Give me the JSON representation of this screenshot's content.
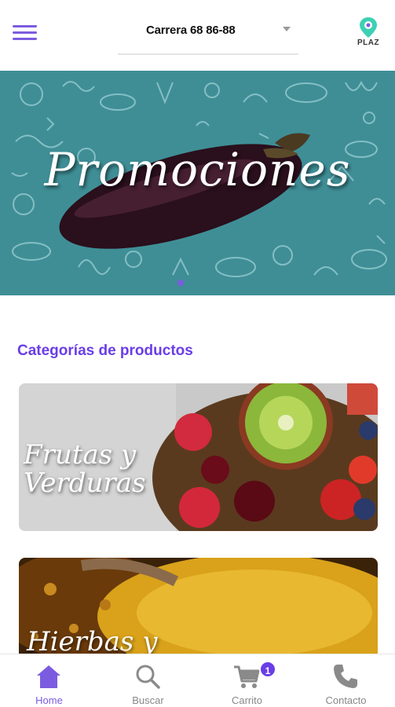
{
  "header": {
    "address": "Carrera 68 86-88",
    "logo_text": "PLAZ"
  },
  "banner": {
    "title": "Promociones",
    "slide_count": 1,
    "active_slide": 1
  },
  "categories": {
    "title": "Categorías de productos",
    "items": [
      {
        "label_line1": "Frutas y",
        "label_line2": "Verduras"
      },
      {
        "label_line1": "Hierbas y",
        "label_line2": ""
      }
    ]
  },
  "bottom_nav": {
    "items": [
      {
        "label": "Home",
        "icon": "home-icon",
        "active": true
      },
      {
        "label": "Buscar",
        "icon": "search-icon",
        "active": false
      },
      {
        "label": "Carrito",
        "icon": "cart-icon",
        "active": false,
        "badge": "1"
      },
      {
        "label": "Contacto",
        "icon": "phone-icon",
        "active": false
      }
    ]
  },
  "colors": {
    "accent": "#7b5ce0",
    "title_purple": "#6a3de8",
    "banner_bg": "#3f8e96"
  }
}
